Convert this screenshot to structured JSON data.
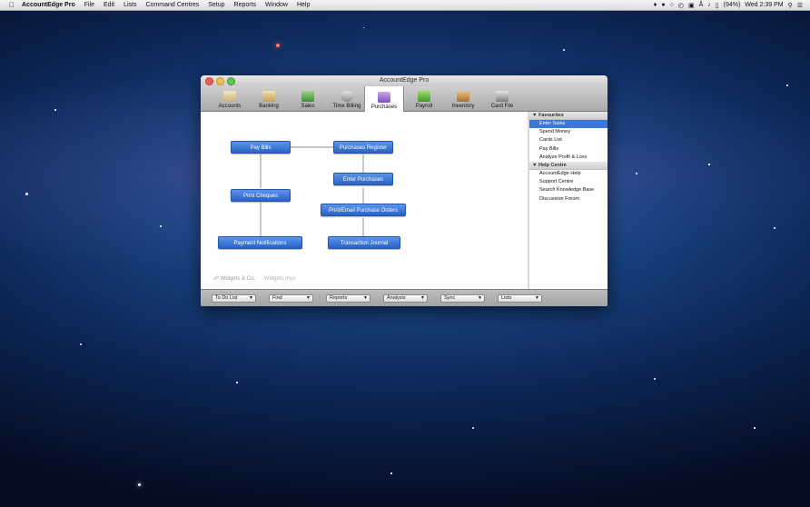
{
  "menubar": {
    "app_name": "AccountEdge Pro",
    "items": [
      "File",
      "Edit",
      "Lists",
      "Command Centres",
      "Setup",
      "Reports",
      "Window",
      "Help"
    ],
    "battery": "(94%)",
    "clock": "Wed 2:39 PM"
  },
  "window": {
    "title": "AccountEdge Pro",
    "tabs": [
      {
        "label": "Accounts",
        "icon": "accounts-icon"
      },
      {
        "label": "Banking",
        "icon": "banking-icon"
      },
      {
        "label": "Sales",
        "icon": "sales-icon"
      },
      {
        "label": "Time Billing",
        "icon": "time-billing-icon"
      },
      {
        "label": "Purchases",
        "icon": "purchases-icon",
        "active": true
      },
      {
        "label": "Payroll",
        "icon": "payroll-icon"
      },
      {
        "label": "Inventory",
        "icon": "inventory-icon"
      },
      {
        "label": "Card File",
        "icon": "card-file-icon"
      }
    ],
    "flow": {
      "pay_bills": "Pay Bills",
      "purchases_register": "Purchases Register",
      "enter_purchases": "Enter Purchases",
      "print_cheques": "Print Cheques",
      "print_email_purchase_orders": "Print/Email Purchase Orders",
      "payment_notifications": "Payment Notifications",
      "transaction_journal": "Transaction Journal"
    },
    "company": "Widgets & Co.",
    "file_name": "Widgets.myo",
    "sidebar": {
      "favourites_header": "Favourites",
      "favourites": [
        "Enter Sales",
        "Spend Money",
        "Cards List",
        "Pay Bills",
        "Analyze Profit & Loss"
      ],
      "help_header": "Help Centre",
      "help": [
        "AccountEdge Help",
        "Support Centre",
        "Search Knowledge Base",
        "Discussion Forum"
      ]
    },
    "bottom_menus": [
      "To Do List",
      "Find",
      "Reports",
      "Analysis",
      "Sync",
      "Lists"
    ]
  },
  "colors": {
    "flow_button": "#3b78d8",
    "selected_item": "#3b78d8"
  }
}
